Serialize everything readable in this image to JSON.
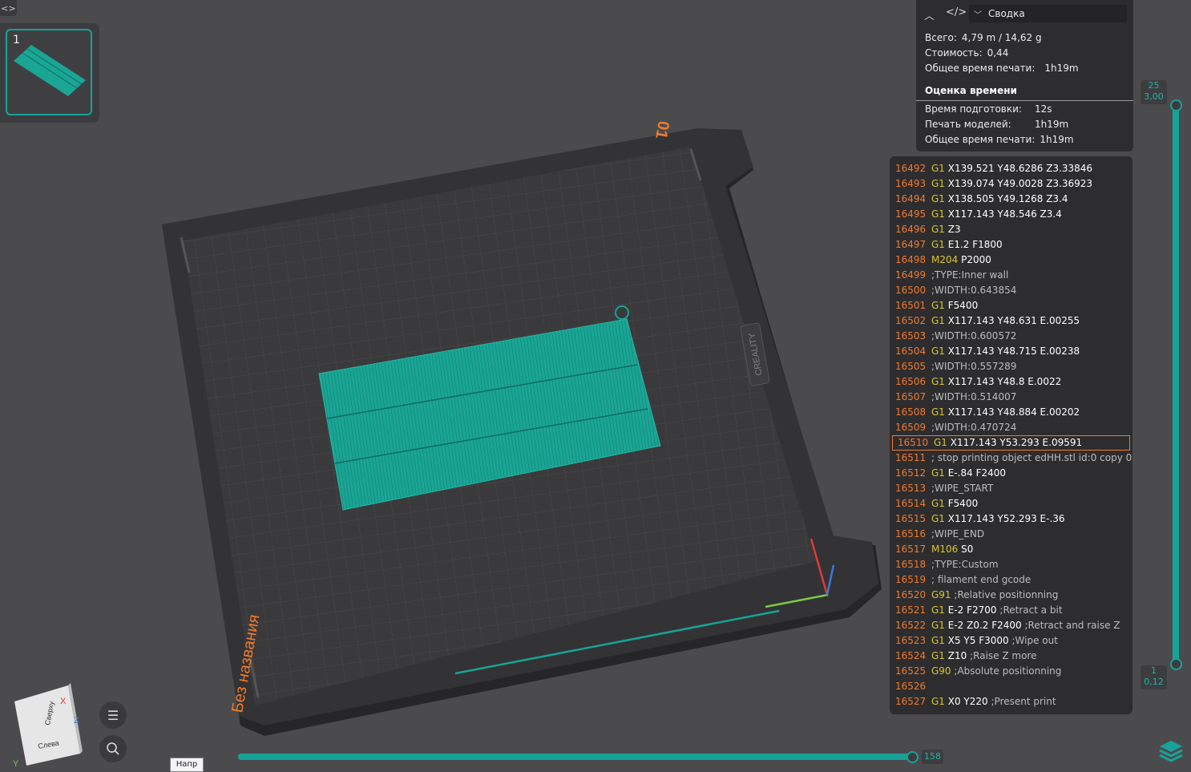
{
  "toolbar": {
    "collapse_icon": "code-brackets-icon",
    "plate_number": "1"
  },
  "viewport": {
    "plate_name": "Без названия",
    "plate_index": "01",
    "brand": "CREALITY",
    "view_cube": {
      "top": "Сверху",
      "left": "Слева",
      "x": "X",
      "y": "Y",
      "z": "Z"
    },
    "tooltip": "Напр"
  },
  "summary": {
    "view_select": "Сводка",
    "rows": [
      {
        "label": "Всего:",
        "value": "4,79 m / 14,62 g"
      },
      {
        "label": "Стоимость:",
        "value": "0,44"
      },
      {
        "label": "Общее время печати:",
        "value": "1h19m"
      }
    ],
    "time_title": "Оценка времени",
    "time_rows": [
      {
        "label": "Время подготовки:",
        "value": "12s"
      },
      {
        "label": "Печать моделей:",
        "value": "1h19m"
      },
      {
        "label": "Общее время печати:",
        "value": "1h19m"
      }
    ]
  },
  "gcode": {
    "selected_line": "16510",
    "lines": [
      {
        "n": "16492",
        "cmd": "G1",
        "args": "X139.521 Y48.6286 Z3.33846",
        "cmt": ""
      },
      {
        "n": "16493",
        "cmd": "G1",
        "args": "X139.074 Y49.0028 Z3.36923",
        "cmt": ""
      },
      {
        "n": "16494",
        "cmd": "G1",
        "args": "X138.505 Y49.1268 Z3.4",
        "cmt": ""
      },
      {
        "n": "16495",
        "cmd": "G1",
        "args": "X117.143 Y48.546 Z3.4",
        "cmt": ""
      },
      {
        "n": "16496",
        "cmd": "G1",
        "args": "Z3",
        "cmt": ""
      },
      {
        "n": "16497",
        "cmd": "G1",
        "args": "E1.2 F1800",
        "cmt": ""
      },
      {
        "n": "16498",
        "cmd": "M204",
        "args": "P2000",
        "cmt": ""
      },
      {
        "n": "16499",
        "cmd": "",
        "args": "",
        "cmt": ";TYPE:Inner wall"
      },
      {
        "n": "16500",
        "cmd": "",
        "args": "",
        "cmt": ";WIDTH:0.643854"
      },
      {
        "n": "16501",
        "cmd": "G1",
        "args": "F5400",
        "cmt": ""
      },
      {
        "n": "16502",
        "cmd": "G1",
        "args": "X117.143 Y48.631 E.00255",
        "cmt": ""
      },
      {
        "n": "16503",
        "cmd": "",
        "args": "",
        "cmt": ";WIDTH:0.600572"
      },
      {
        "n": "16504",
        "cmd": "G1",
        "args": "X117.143 Y48.715 E.00238",
        "cmt": ""
      },
      {
        "n": "16505",
        "cmd": "",
        "args": "",
        "cmt": ";WIDTH:0.557289"
      },
      {
        "n": "16506",
        "cmd": "G1",
        "args": "X117.143 Y48.8 E.0022",
        "cmt": ""
      },
      {
        "n": "16507",
        "cmd": "",
        "args": "",
        "cmt": ";WIDTH:0.514007"
      },
      {
        "n": "16508",
        "cmd": "G1",
        "args": "X117.143 Y48.884 E.00202",
        "cmt": ""
      },
      {
        "n": "16509",
        "cmd": "",
        "args": "",
        "cmt": ";WIDTH:0.470724"
      },
      {
        "n": "16510",
        "cmd": "G1",
        "args": "X117.143 Y53.293 E.09591",
        "cmt": ""
      },
      {
        "n": "16511",
        "cmd": "",
        "args": "",
        "cmt": "; stop printing object edHH.stl id:0 copy 0"
      },
      {
        "n": "16512",
        "cmd": "G1",
        "args": "E-.84 F2400",
        "cmt": ""
      },
      {
        "n": "16513",
        "cmd": "",
        "args": "",
        "cmt": ";WIPE_START"
      },
      {
        "n": "16514",
        "cmd": "G1",
        "args": "F5400",
        "cmt": ""
      },
      {
        "n": "16515",
        "cmd": "G1",
        "args": "X117.143 Y52.293 E-.36",
        "cmt": ""
      },
      {
        "n": "16516",
        "cmd": "",
        "args": "",
        "cmt": ";WIPE_END"
      },
      {
        "n": "16517",
        "cmd": "M106",
        "args": "S0",
        "cmt": ""
      },
      {
        "n": "16518",
        "cmd": "",
        "args": "",
        "cmt": ";TYPE:Custom"
      },
      {
        "n": "16519",
        "cmd": "",
        "args": "",
        "cmt": "; filament end gcode"
      },
      {
        "n": "16520",
        "cmd": "G91",
        "args": "",
        "cmt": ";Relative positionning"
      },
      {
        "n": "16521",
        "cmd": "G1",
        "args": "E-2 F2700",
        "cmt": ";Retract a bit"
      },
      {
        "n": "16522",
        "cmd": "G1",
        "args": "E-2 Z0.2 F2400",
        "cmt": ";Retract and raise Z"
      },
      {
        "n": "16523",
        "cmd": "G1",
        "args": "X5 Y5 F3000",
        "cmt": ";Wipe out"
      },
      {
        "n": "16524",
        "cmd": "G1",
        "args": "Z10",
        "cmt": ";Raise Z more"
      },
      {
        "n": "16525",
        "cmd": "G90",
        "args": "",
        "cmt": ";Absolute positionning"
      },
      {
        "n": "16526",
        "cmd": "",
        "args": "",
        "cmt": ""
      },
      {
        "n": "16527",
        "cmd": "G1",
        "args": "X0 Y220",
        "cmt": ";Present print"
      }
    ]
  },
  "layer_slider": {
    "top_layer": "25",
    "top_height": "3,00",
    "bottom_layer": "1",
    "bottom_height": "0,12"
  },
  "move_slider": {
    "value": "158"
  },
  "colors": {
    "accent": "#17a398",
    "label_orange": "#f07a2e",
    "gcode_command": "#d8c431"
  }
}
